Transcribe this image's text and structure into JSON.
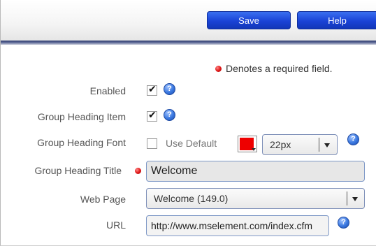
{
  "toolbar": {
    "save_label": "Save",
    "help_label": "Help"
  },
  "required_note": "Denotes a required field.",
  "fields": {
    "enabled": {
      "label": "Enabled",
      "checked": true
    },
    "group_heading_item": {
      "label": "Group Heading Item",
      "checked": true
    },
    "group_heading_font": {
      "label": "Group Heading Font",
      "use_default_label": "Use Default",
      "use_default_checked": false,
      "color": "#ee0000",
      "size_value": "22px"
    },
    "group_heading_title": {
      "label": "Group Heading Title",
      "value": "Welcome",
      "required": true
    },
    "web_page": {
      "label": "Web Page",
      "value": "Welcome (149.0)"
    },
    "url": {
      "label": "URL",
      "value": "http://www.mselement.com/index.cfm"
    }
  },
  "icons": {
    "help": "help-icon",
    "required": "required-dot-icon",
    "checkmark": "checkmark-icon",
    "dropdown": "chevron-down-icon"
  },
  "colors": {
    "button_blue": "#1a43d6",
    "required_red": "#e11b1b",
    "help_blue": "#3a78e0"
  }
}
